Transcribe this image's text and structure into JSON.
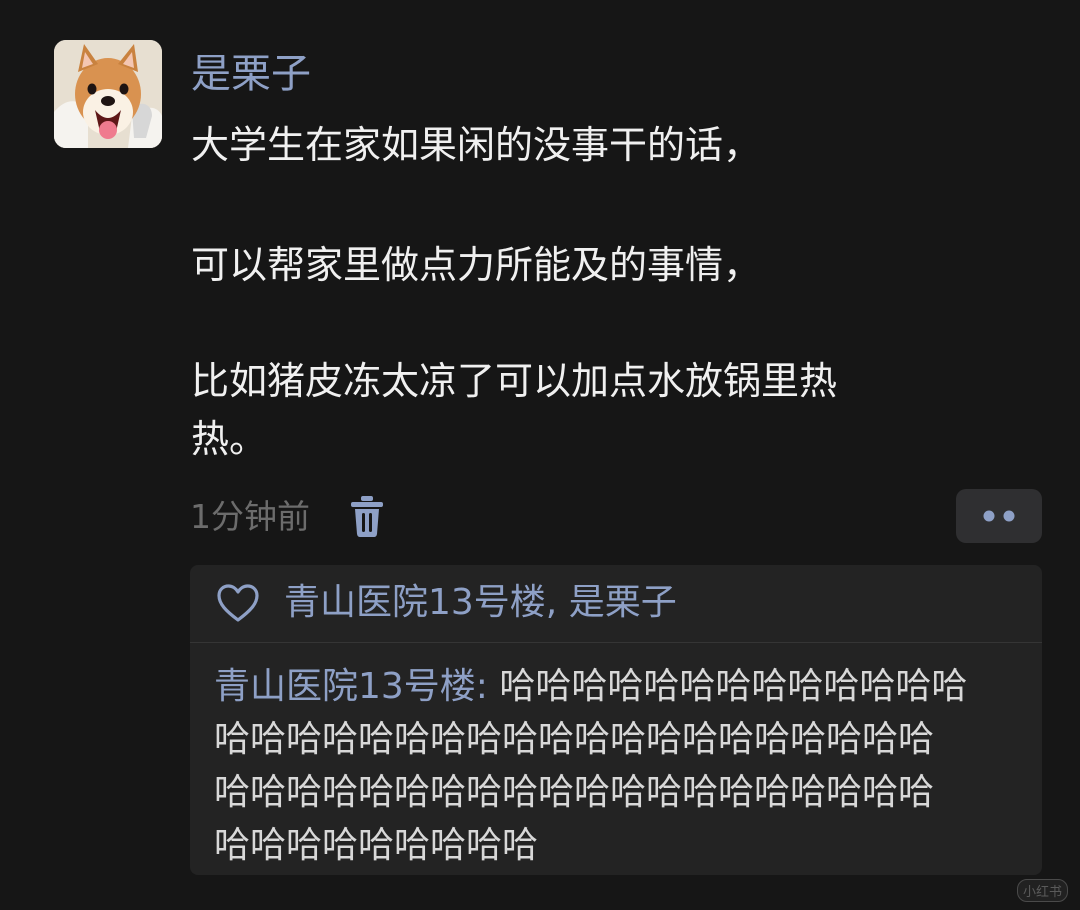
{
  "comment": {
    "author": "是栗子",
    "avatar": "shiba-inu-dog-avatar",
    "lines": [
      "大学生在家如果闲的没事干的话，",
      "可以帮家里做点力所能及的事情，",
      "比如猪皮冻太凉了可以加点水放锅里热",
      "热。"
    ],
    "time": "1分钟前",
    "delete_icon": "trash-icon",
    "more_icon": "more-dots-icon"
  },
  "reply_section": {
    "like_icon": "heart-icon",
    "liked_by": "青山医院13号楼, 是栗子",
    "reply_author": "青山医院13号楼:",
    "reply_lines": [
      " 哈哈哈哈哈哈哈哈哈哈哈哈哈",
      "哈哈哈哈哈哈哈哈哈哈哈哈哈哈哈哈哈哈哈哈",
      "哈哈哈哈哈哈哈哈哈哈哈哈哈哈哈哈哈哈哈哈",
      "哈哈哈哈哈哈哈哈哈"
    ]
  },
  "watermark": "小红书",
  "colors": {
    "background": "#161616",
    "name": "#8ea0c6",
    "text": "#f0f0f0",
    "muted": "#6c6c6c",
    "panel": "#232323"
  }
}
